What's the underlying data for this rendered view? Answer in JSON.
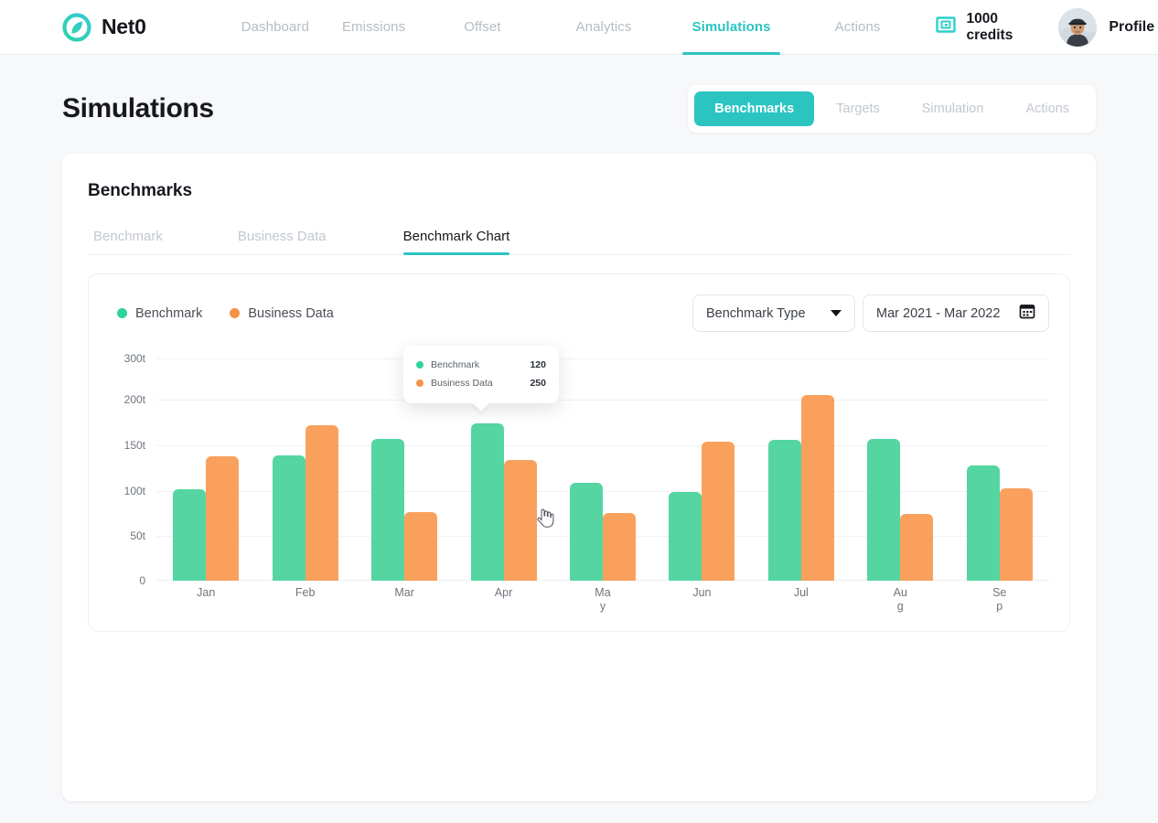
{
  "nav": {
    "brand": "Net0",
    "brand_icon": "net0-leaf-logo-icon",
    "links": [
      {
        "label": "Dashboard",
        "active": false
      },
      {
        "label": "Emissions",
        "active": false
      },
      {
        "label": "Offset",
        "active": false
      },
      {
        "label": "Analytics",
        "active": false
      },
      {
        "label": "Simulations",
        "active": true
      },
      {
        "label": "Actions",
        "active": false
      }
    ],
    "credits": {
      "label": "1000 credits",
      "icon": "credits-card-icon"
    },
    "profile": {
      "label": "Profile",
      "avatar_icon": "user-avatar",
      "caret_icon": "chevron-down-icon"
    }
  },
  "page": {
    "title": "Simulations",
    "segments": [
      {
        "label": "Benchmarks",
        "active": true
      },
      {
        "label": "Targets",
        "active": false
      },
      {
        "label": "Simulation",
        "active": false
      },
      {
        "label": "Actions",
        "active": false
      }
    ]
  },
  "card": {
    "title": "Benchmarks",
    "tabs": [
      {
        "label": "Benchmark",
        "active": false
      },
      {
        "label": "Business Data",
        "active": false
      },
      {
        "label": "Benchmark Chart",
        "active": true
      }
    ]
  },
  "chart_controls": {
    "benchmark_type": {
      "value": "Benchmark Type",
      "icon": "chevron-down-icon"
    },
    "date_range": {
      "value": "Mar 2021 - Mar 2022",
      "icon": "calendar-icon"
    }
  },
  "tooltip": {
    "rows": [
      {
        "name": "Benchmark",
        "value": "120",
        "color": "#55d5a2"
      },
      {
        "name": "Business Data",
        "value": "250",
        "color": "#f9a15c"
      }
    ]
  },
  "colors": {
    "accent_teal": "#2bc4c1",
    "benchmark_green": "#55d5a2",
    "business_orange": "#f9a15c",
    "page_bg": "#f7f8fa",
    "text_dark": "#16181d",
    "text_muted": "#c3c8ce"
  },
  "chart_data": {
    "type": "bar",
    "title": "",
    "xlabel": "",
    "ylabel": "",
    "grid": true,
    "legend_position": "top-left",
    "categories": [
      "Jan",
      "Feb",
      "Mar",
      "Apr",
      "May",
      "Jun",
      "Jul",
      "Aug",
      "Sep"
    ],
    "ytick_labels": [
      "0",
      "50t",
      "100t",
      "150t",
      "200t",
      "300t"
    ],
    "ytick_values": [
      0,
      50,
      100,
      150,
      200,
      300
    ],
    "ylim": [
      0,
      300
    ],
    "series": [
      {
        "name": "Benchmark",
        "color": "#55d5a2",
        "values": [
          100,
          140,
          157,
          165,
          112,
          102,
          155,
          156,
          132
        ]
      },
      {
        "name": "Business Data",
        "color": "#f9a15c",
        "values": [
          143,
          172,
          78,
          133,
          77,
          152,
          213,
          76,
          105
        ]
      }
    ]
  }
}
